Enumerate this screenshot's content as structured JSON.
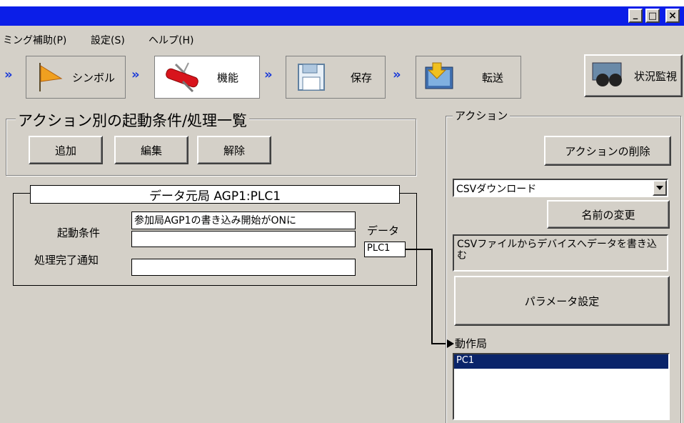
{
  "menu": {
    "items": [
      "ミング補助(P)",
      "設定(S)",
      "ヘルプ(H)"
    ]
  },
  "window_buttons": {
    "minimize": "_",
    "maximize": "□",
    "close": "×"
  },
  "toolbar": {
    "steps": [
      {
        "label": "シンボル",
        "icon": "flag-icon"
      },
      {
        "label": "機能",
        "icon": "swiss-knife-icon"
      },
      {
        "label": "保存",
        "icon": "floppy-disk-icon"
      },
      {
        "label": "転送",
        "icon": "transfer-icon"
      }
    ],
    "monitor_label": "状況監視",
    "chevron": "»"
  },
  "action_list": {
    "title": "アクション別の起動条件/処理一覧",
    "add_label": "追加",
    "edit_label": "編集",
    "remove_label": "解除"
  },
  "source_station": {
    "header": "データ元局 AGP1:PLC1",
    "trigger_label": "起動条件",
    "trigger_value": "参加局AGP1の書き込み開始がONに",
    "trigger_value2": "",
    "completion_label": "処理完了通知",
    "completion_value": "",
    "data_label": "データ",
    "data_value": "PLC1"
  },
  "action_panel": {
    "title": "アクション",
    "delete_label": "アクションの削除",
    "selected_action": "CSVダウンロード",
    "rename_label": "名前の変更",
    "description": "CSVファイルからデバイスへデータを書き込む",
    "params_label": "パラメータ設定",
    "operation_station_label": "動作局",
    "operation_stations": [
      "PC1"
    ]
  },
  "colors": {
    "titlebar": "#0b1ee8",
    "selection": "#0a246a",
    "chevron": "#1a3ad8",
    "face": "#d4d0c8"
  }
}
